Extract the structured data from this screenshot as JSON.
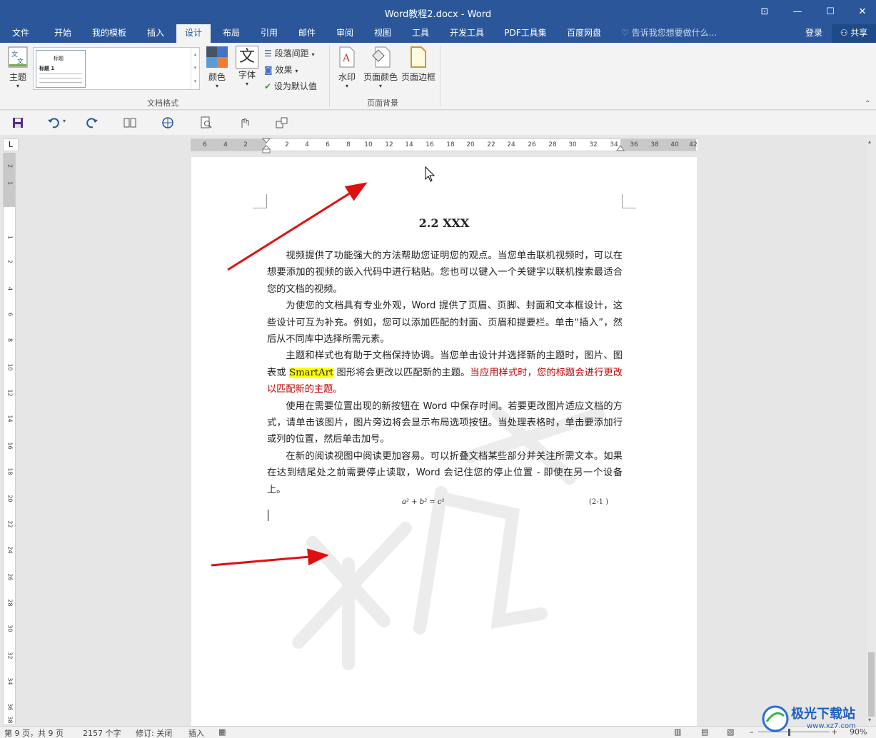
{
  "window": {
    "title": "Word教程2.docx - Word",
    "controls": {
      "ribbon_display": "⊡",
      "minimize": "—",
      "maximize": "☐",
      "close": "✕"
    }
  },
  "tabs": [
    {
      "label": "文件",
      "active": false
    },
    {
      "label": "开始",
      "active": false
    },
    {
      "label": "我的模板",
      "active": false
    },
    {
      "label": "插入",
      "active": false
    },
    {
      "label": "设计",
      "active": true
    },
    {
      "label": "布局",
      "active": false
    },
    {
      "label": "引用",
      "active": false
    },
    {
      "label": "邮件",
      "active": false
    },
    {
      "label": "审阅",
      "active": false
    },
    {
      "label": "视图",
      "active": false
    },
    {
      "label": "工具",
      "active": false
    },
    {
      "label": "开发工具",
      "active": false
    },
    {
      "label": "PDF工具集",
      "active": false
    },
    {
      "label": "百度网盘",
      "active": false
    }
  ],
  "tell_me": {
    "placeholder": "告诉我您想要做什么..."
  },
  "account": {
    "login": "登录",
    "share": "共享"
  },
  "ribbon": {
    "theme": "主题",
    "gallery_thumb_title": "标题",
    "gallery_thumb_heading": "标题 1",
    "colors": "颜色",
    "fonts": "字体",
    "fonts_icon_glyph": "文",
    "paragraph_spacing": "段落间距",
    "effects": "效果",
    "set_default": "设为默认值",
    "group_document_format": "文档格式",
    "watermark": "水印",
    "page_color": "页面颜色",
    "page_borders": "页面边框",
    "group_page_background": "页面背景"
  },
  "ruler": {
    "corner": "L",
    "horizontal": [
      "6",
      "4",
      "2",
      "2",
      "4",
      "6",
      "8",
      "10",
      "12",
      "14",
      "16",
      "18",
      "20",
      "22",
      "24",
      "26",
      "28",
      "30",
      "32",
      "34",
      "36",
      "38",
      "40",
      "42"
    ],
    "vertical": [
      "2",
      "1",
      "1",
      "2",
      "4",
      "6",
      "8",
      "10",
      "12",
      "14",
      "16",
      "18",
      "20",
      "22",
      "24",
      "26",
      "28",
      "30",
      "32",
      "34",
      "36",
      "38"
    ]
  },
  "document": {
    "heading": "2.2 XXX",
    "paragraphs": [
      {
        "text": "视频提供了功能强大的方法帮助您证明您的观点。当您单击联机视频时，可以在想要添加的视频的嵌入代码中进行粘贴。您也可以键入一个关键字以联机搜索最适合您的文档的视频。"
      },
      {
        "text": "为使您的文档具有专业外观，Word 提供了页眉、页脚、封面和文本框设计，这些设计可互为补充。例如，您可以添加匹配的封面、页眉和提要栏。单击“插入”，然后从不同库中选择所需元素。"
      },
      {
        "pre": "主题和样式也有助于文档保持协调。当您单击设计并选择新的主题时，图片、图表或 ",
        "highlight": "SmartArt",
        "mid": " 图形将会更改以匹配新的主题。",
        "red": "当应用样式时，您的标题会进行更改以匹配新的主题。"
      },
      {
        "text": "使用在需要位置出现的新按钮在 Word 中保存时间。若要更改图片适应文档的方式，请单击该图片，图片旁边将会显示布局选项按钮。当处理表格时，单击要添加行或列的位置，然后单击加号。"
      },
      {
        "text": "在新的阅读视图中阅读更加容易。可以折叠文档某些部分并关注所需文本。如果在达到结尾处之前需要停止读取，Word 会记住您的停止位置 - 即使在另一个设备上。"
      }
    ],
    "formula": "a² + b² = c²",
    "equation_number": "(2-1 )"
  },
  "statusbar": {
    "page": "第 9 页，共 9 页",
    "words": "2157 个字",
    "track_changes": "修订: 关闭",
    "insert_mode": "插入",
    "zoom": "90%"
  },
  "watermark_logo": {
    "text": "极光下载站",
    "url_text": "www.xz7.com"
  },
  "colors": {
    "accent": "#2b579a",
    "arrow": "#e01010",
    "highlight": "#ffff00",
    "red_text": "#c00000"
  }
}
